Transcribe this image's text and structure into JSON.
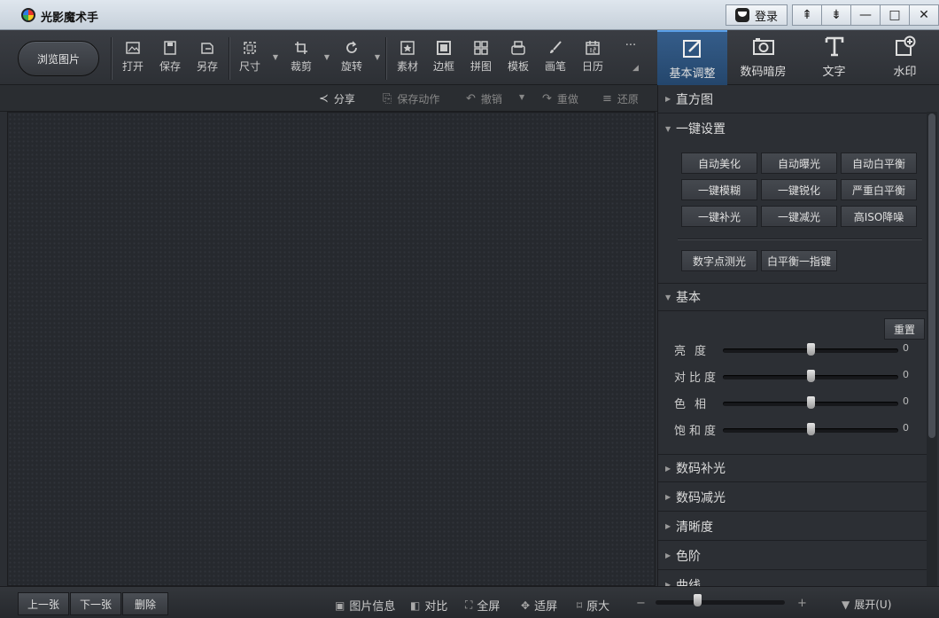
{
  "app": {
    "title": "光影魔术手"
  },
  "window": {
    "login_label": "登录",
    "buttons": [
      "⇞",
      "⇟",
      "—",
      "□",
      "✕"
    ]
  },
  "toolbar": {
    "browse_label": "浏览图片",
    "tools": [
      {
        "label": "打开",
        "icon": "open-icon"
      },
      {
        "label": "保存",
        "icon": "save-icon"
      },
      {
        "label": "另存",
        "icon": "save-as-icon"
      },
      {
        "label": "尺寸",
        "icon": "resize-icon"
      },
      {
        "label": "裁剪",
        "icon": "crop-icon"
      },
      {
        "label": "旋转",
        "icon": "rotate-icon"
      },
      {
        "label": "素材",
        "icon": "material-icon"
      },
      {
        "label": "边框",
        "icon": "border-icon"
      },
      {
        "label": "拼图",
        "icon": "collage-icon"
      },
      {
        "label": "模板",
        "icon": "template-icon"
      },
      {
        "label": "画笔",
        "icon": "brush-icon"
      },
      {
        "label": "日历",
        "icon": "calendar-icon"
      }
    ],
    "more_label": "···"
  },
  "right_tabs": [
    {
      "label": "基本调整",
      "icon": "basic-adjust-icon",
      "active": true
    },
    {
      "label": "数码暗房",
      "icon": "camera-icon",
      "active": false
    },
    {
      "label": "文字",
      "icon": "text-icon",
      "active": false
    },
    {
      "label": "水印",
      "icon": "watermark-icon",
      "active": false
    }
  ],
  "subbar": {
    "share": "分享",
    "save_action": "保存动作",
    "undo": "撤销",
    "redo": "重做",
    "restore": "还原"
  },
  "panel": {
    "histogram": "直方图",
    "one_click": {
      "title": "一键设置",
      "buttons": [
        "自动美化",
        "自动曝光",
        "自动白平衡",
        "一键模糊",
        "一键锐化",
        "严重白平衡",
        "一键补光",
        "一键减光",
        "高ISO降噪"
      ],
      "extra": [
        "数字点测光",
        "白平衡一指键"
      ]
    },
    "basic": {
      "title": "基本",
      "reset": "重置",
      "sliders": [
        {
          "label": "亮度",
          "value": 0
        },
        {
          "label": "对比度",
          "value": 0
        },
        {
          "label": "色相",
          "value": 0
        },
        {
          "label": "饱和度",
          "value": 0
        }
      ]
    },
    "sections": [
      "数码补光",
      "数码减光",
      "清晰度",
      "色阶",
      "曲线"
    ]
  },
  "bottom": {
    "prev": "上一张",
    "next": "下一张",
    "delete": "删除",
    "info": "图片信息",
    "compare": "对比",
    "fullscreen": "全屏",
    "fit": "适屏",
    "original": "原大",
    "zoom_minus": "−",
    "zoom_plus": "+",
    "expand": "展开(U)"
  }
}
